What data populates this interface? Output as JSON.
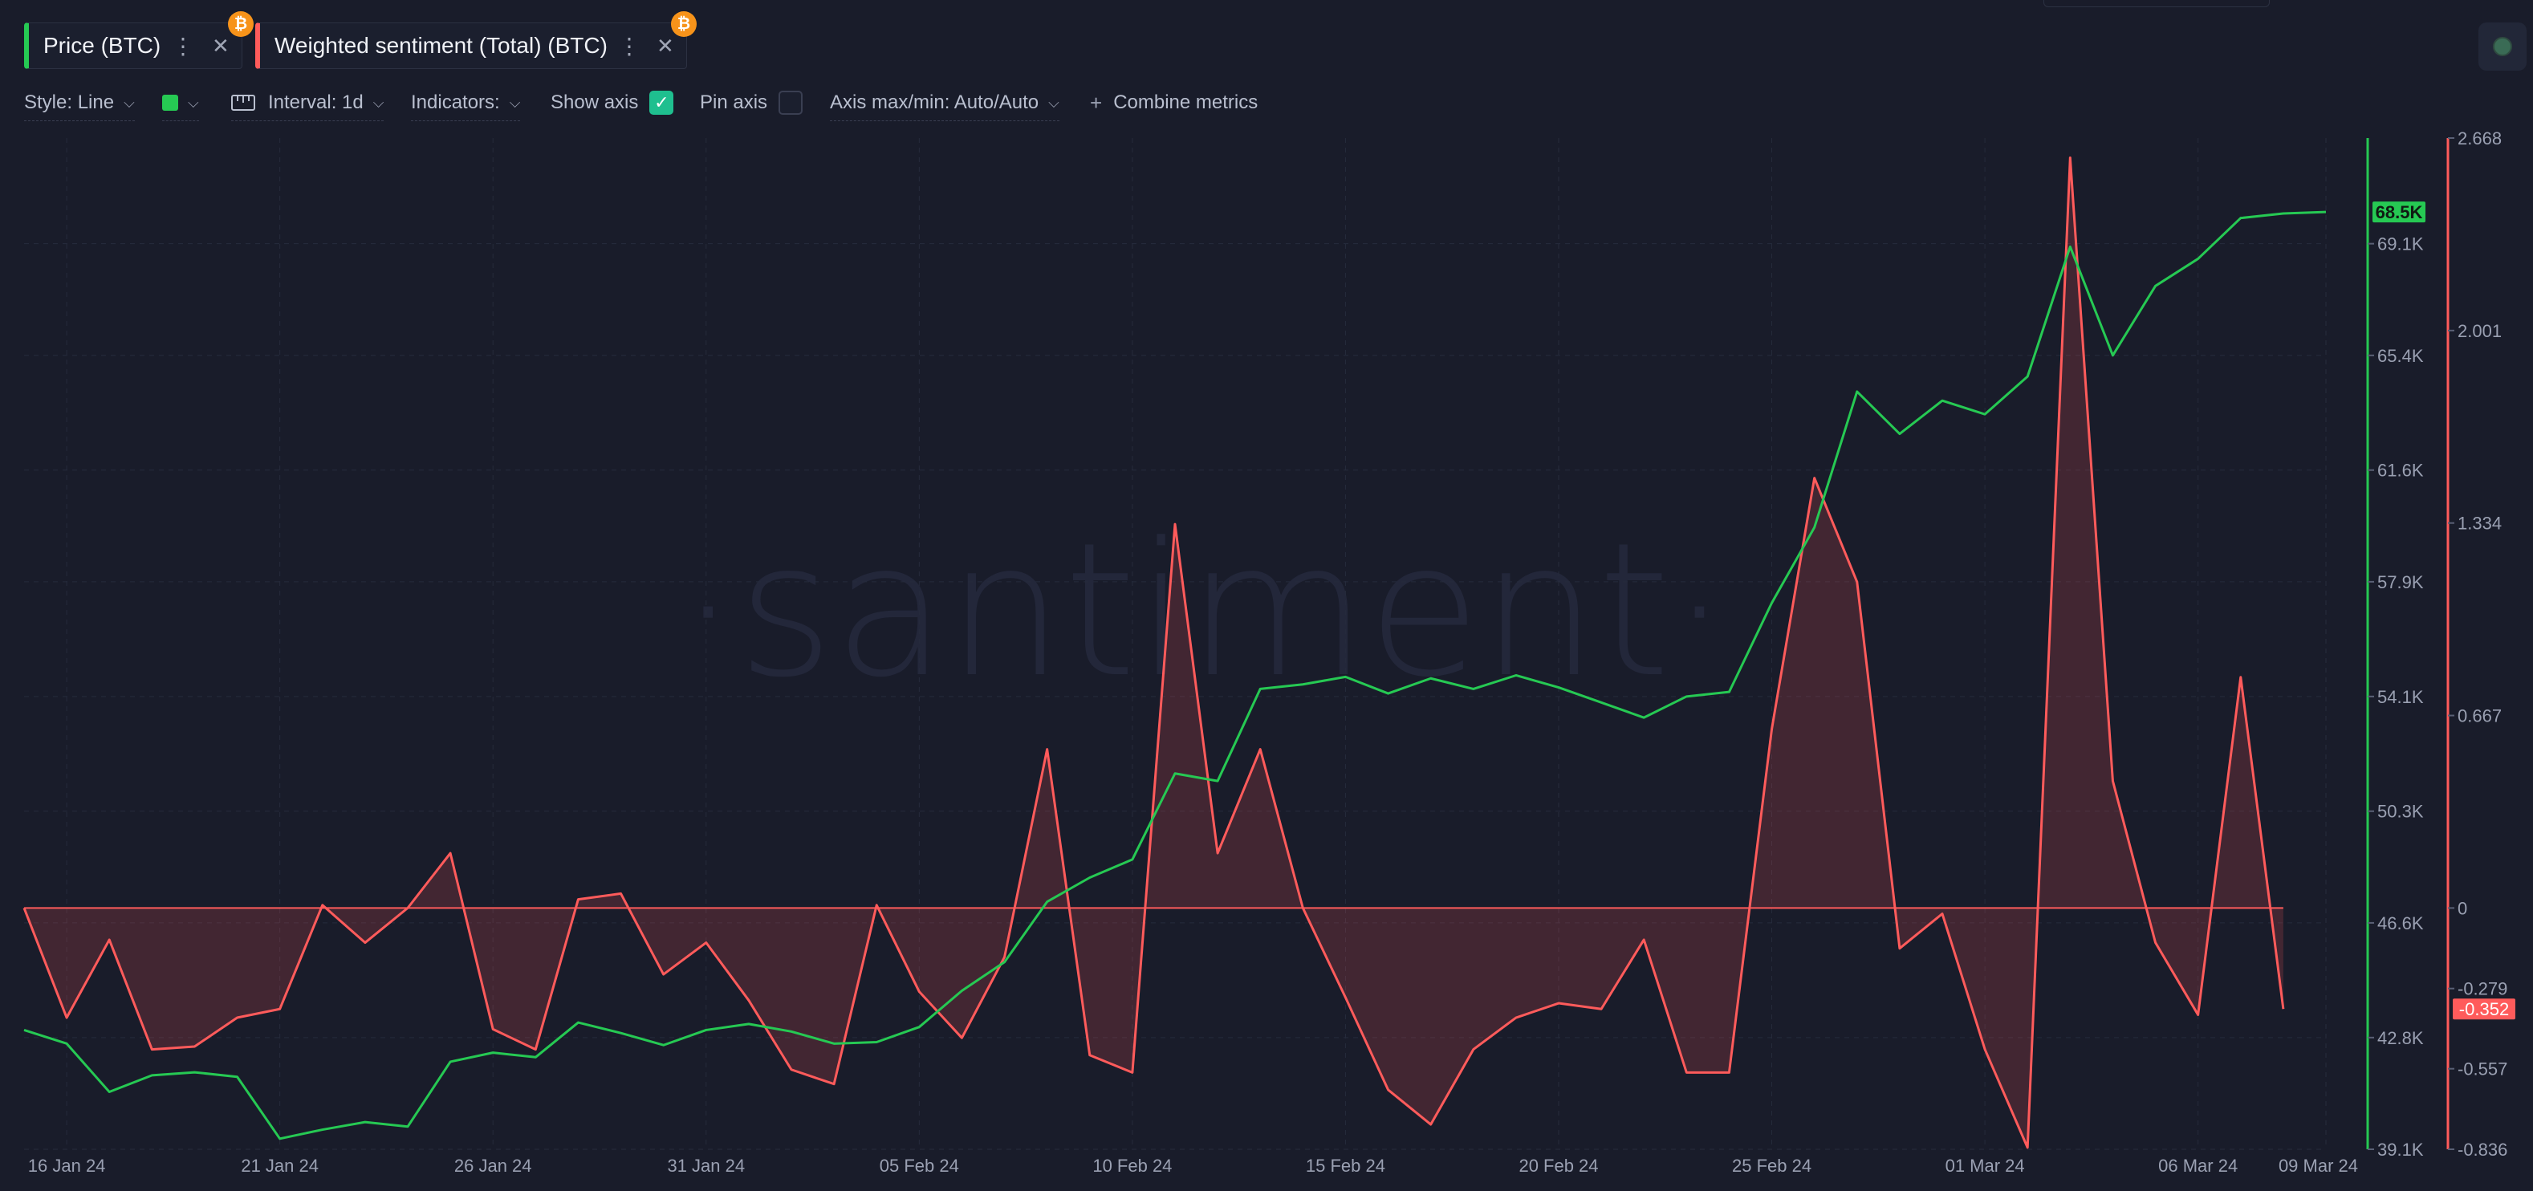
{
  "tabs": [
    {
      "label": "Price (BTC)",
      "color": "#26c953",
      "badge": "₿"
    },
    {
      "label": "Weighted sentiment (Total) (BTC)",
      "color": "#ff5b5b",
      "badge": "₿"
    }
  ],
  "toolbar": {
    "style_label": "Style: Line",
    "interval_label": "Interval: 1d",
    "indicators_label": "Indicators:",
    "show_axis_label": "Show axis",
    "show_axis_checked": true,
    "pin_axis_label": "Pin axis",
    "pin_axis_checked": false,
    "axis_minmax_label": "Axis max/min: Auto/Auto",
    "combine_label": "Combine metrics",
    "plus_icon": "+"
  },
  "watermark": "·santiment·",
  "chart_data": {
    "type": "line",
    "x": [
      "15 Jan 24",
      "16 Jan 24",
      "17 Jan 24",
      "18 Jan 24",
      "19 Jan 24",
      "20 Jan 24",
      "21 Jan 24",
      "22 Jan 24",
      "23 Jan 24",
      "24 Jan 24",
      "25 Jan 24",
      "26 Jan 24",
      "27 Jan 24",
      "28 Jan 24",
      "29 Jan 24",
      "30 Jan 24",
      "31 Jan 24",
      "01 Feb 24",
      "02 Feb 24",
      "03 Feb 24",
      "04 Feb 24",
      "05 Feb 24",
      "06 Feb 24",
      "07 Feb 24",
      "08 Feb 24",
      "09 Feb 24",
      "10 Feb 24",
      "11 Feb 24",
      "12 Feb 24",
      "13 Feb 24",
      "14 Feb 24",
      "15 Feb 24",
      "16 Feb 24",
      "17 Feb 24",
      "18 Feb 24",
      "19 Feb 24",
      "20 Feb 24",
      "21 Feb 24",
      "22 Feb 24",
      "23 Feb 24",
      "24 Feb 24",
      "25 Feb 24",
      "26 Feb 24",
      "27 Feb 24",
      "28 Feb 24",
      "29 Feb 24",
      "01 Mar 24",
      "02 Mar 24",
      "03 Mar 24",
      "04 Mar 24",
      "05 Mar 24",
      "06 Mar 24",
      "07 Mar 24",
      "08 Mar 24",
      "09 Mar 24"
    ],
    "x_ticks": [
      "16 Jan 24",
      "21 Jan 24",
      "26 Jan 24",
      "31 Jan 24",
      "05 Feb 24",
      "10 Feb 24",
      "15 Feb 24",
      "20 Feb 24",
      "25 Feb 24",
      "01 Mar 24",
      "06 Mar 24",
      "09 Mar 24"
    ],
    "series": [
      {
        "name": "Price (BTC)",
        "axis": "left",
        "color": "#26c953",
        "values": [
          43050,
          42600,
          41000,
          41550,
          41650,
          41500,
          39450,
          39750,
          40000,
          39850,
          42000,
          42300,
          42150,
          43300,
          42950,
          42550,
          43050,
          43250,
          43000,
          42600,
          42650,
          43150,
          44350,
          45300,
          47300,
          48100,
          48700,
          51550,
          51300,
          54350,
          54500,
          54750,
          54200,
          54700,
          54350,
          54800,
          54400,
          53900,
          53400,
          54100,
          54250,
          57200,
          59700,
          64200,
          62800,
          63900,
          63450,
          64700,
          69000,
          65400,
          67700,
          68600,
          69950,
          70100,
          70150
        ],
        "last_value_label": "68.5K"
      },
      {
        "name": "Weighted sentiment (Total) (BTC)",
        "axis": "right",
        "color": "#ff5b5b",
        "values": [
          0,
          -0.38,
          -0.11,
          -0.49,
          -0.48,
          -0.38,
          -0.35,
          0.01,
          -0.12,
          0,
          0.19,
          -0.42,
          -0.49,
          0.03,
          0.05,
          -0.23,
          -0.12,
          -0.32,
          -0.56,
          -0.61,
          0.01,
          -0.29,
          -0.45,
          -0.17,
          0.55,
          -0.51,
          -0.57,
          1.33,
          0.19,
          0.55,
          0,
          -0.31,
          -0.63,
          -0.75,
          -0.49,
          -0.38,
          -0.33,
          -0.35,
          -0.11,
          -0.57,
          -0.57,
          0.62,
          1.49,
          1.13,
          -0.14,
          -0.02,
          -0.49,
          -0.83,
          2.6,
          0.44,
          -0.12,
          -0.37,
          0.8,
          -0.35
        ],
        "last_value_label": "-0.352"
      }
    ],
    "left_axis": {
      "ticks": [
        "39.1K",
        "42.8K",
        "46.6K",
        "50.3K",
        "54.1K",
        "57.9K",
        "61.6K",
        "65.4K",
        "69.1K"
      ],
      "min": 39100,
      "max": 72600
    },
    "right_axis": {
      "ticks": [
        "-0.836",
        "-0.557",
        "-0.279",
        "0",
        "0.667",
        "1.334",
        "2.001",
        "2.668"
      ],
      "min": -0.836,
      "max": 2.668
    },
    "grid": true
  }
}
